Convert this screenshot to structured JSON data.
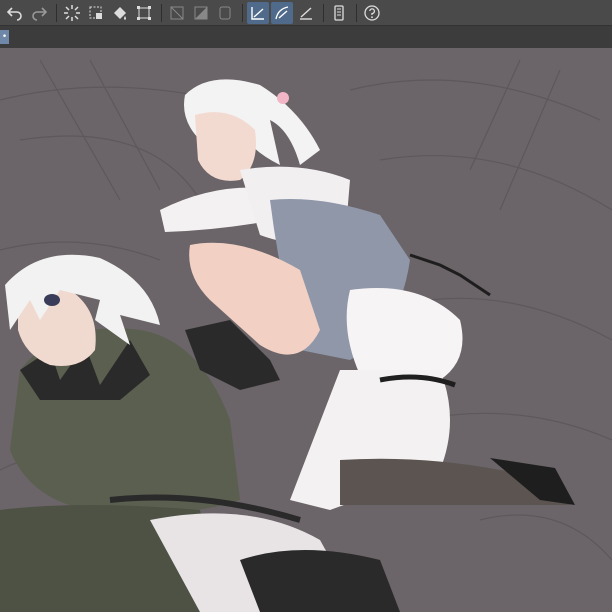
{
  "toolbar": {
    "buttons": [
      {
        "name": "undo-icon"
      },
      {
        "name": "redo-icon"
      },
      {
        "name": "loading-icon"
      },
      {
        "name": "crop-icon"
      },
      {
        "name": "fill-icon"
      },
      {
        "name": "transform-icon"
      },
      {
        "name": "clear-selection-icon"
      },
      {
        "name": "invert-selection-icon"
      },
      {
        "name": "canvas-frame-icon"
      },
      {
        "name": "ruler-snap-icon"
      },
      {
        "name": "curve-snap-icon"
      },
      {
        "name": "perspective-snap-icon"
      },
      {
        "name": "device-icon"
      },
      {
        "name": "help-icon"
      }
    ]
  },
  "subbar": {
    "marker_glyph": "•"
  },
  "colors": {
    "toolbar_bg": "#4a4a4a",
    "active_button_bg": "#4f6a8a",
    "subbar_bg": "#3c3c3c",
    "canvas_bg": "#6b6468"
  }
}
